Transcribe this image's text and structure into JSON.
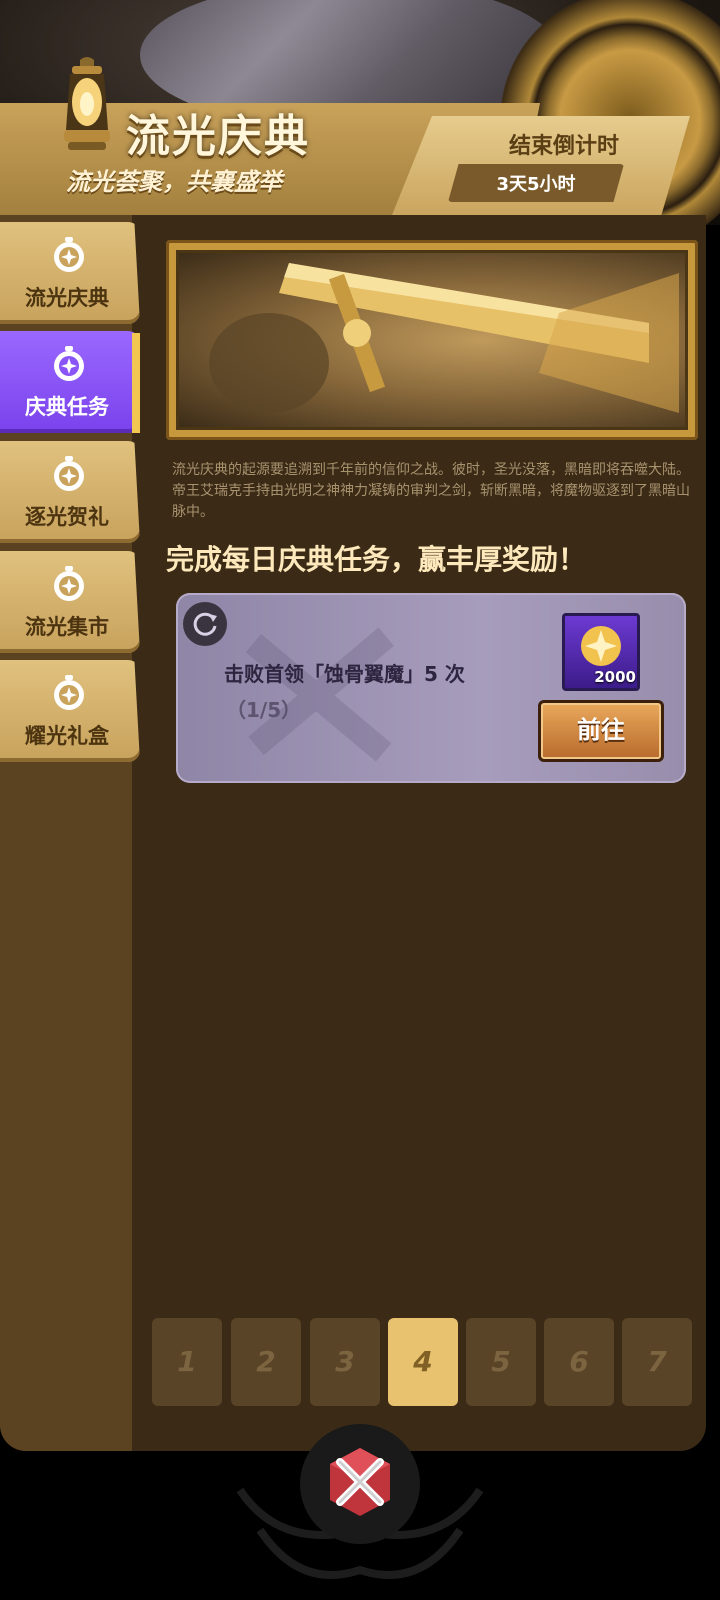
{
  "header": {
    "title": "流光庆典",
    "subtitle": "流光荟聚，共襄盛举",
    "countdown_label": "结束倒计时",
    "countdown_value": "3天5小时"
  },
  "sidebar": {
    "items": [
      {
        "label": "流光庆典",
        "active": false
      },
      {
        "label": "庆典任务",
        "active": true
      },
      {
        "label": "逐光贺礼",
        "active": false
      },
      {
        "label": "流光集市",
        "active": false
      },
      {
        "label": "耀光礼盒",
        "active": false
      }
    ]
  },
  "main": {
    "lore": "流光庆典的起源要追溯到千年前的信仰之战。彼时，圣光没落，黑暗即将吞噬大陆。帝王艾瑞克手持由光明之神神力凝铸的审判之剑，斩断黑暗，将魔物驱逐到了黑暗山脉中。",
    "task_heading": "完成每日庆典任务，赢丰厚奖励！",
    "task": {
      "name": "击败首领「蚀骨翼魔」5 次",
      "progress": "（1/5）",
      "reward_count": "2000",
      "go_label": "前往"
    }
  },
  "days": {
    "items": [
      "1",
      "2",
      "3",
      "4",
      "5",
      "6",
      "7"
    ],
    "selected": "4"
  },
  "colors": {
    "accent_gold": "#e8c26e",
    "active_tab": "#8a55f6",
    "panel": "#3b2a16"
  }
}
